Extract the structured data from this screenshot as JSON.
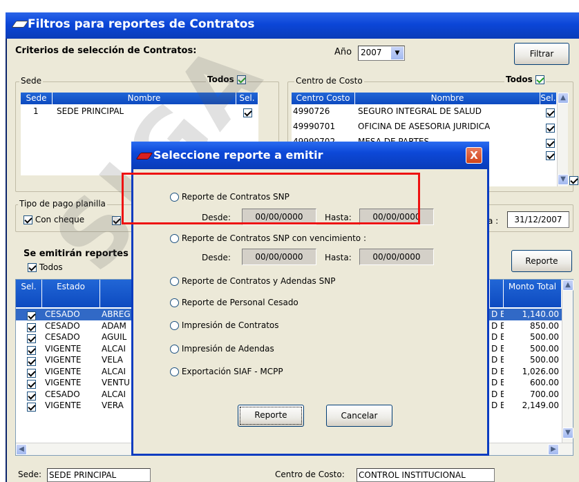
{
  "window": {
    "title": "Filtros para reportes de Contratos"
  },
  "criteria": {
    "label": "Criterios de selección de Contratos:",
    "year_label": "Año",
    "year_value": "2007",
    "filter_button": "Filtrar"
  },
  "sede_group": {
    "title": "Sede",
    "todos_label": "Todos",
    "columns": [
      "Sede",
      "Nombre",
      "Sel."
    ],
    "rows": [
      {
        "sede": "1",
        "nombre": "SEDE PRINCIPAL"
      }
    ]
  },
  "centro_group": {
    "title": "Centro de Costo",
    "todos_label": "Todos",
    "columns": [
      "Centro Costo",
      "Nombre",
      "Sel."
    ],
    "rows": [
      {
        "codigo": "4990726",
        "nombre": "SEGURO INTEGRAL DE SALUD"
      },
      {
        "codigo": "49990701",
        "nombre": "OFICINA DE ASESORIA JURIDICA"
      },
      {
        "codigo": "49990702",
        "nombre": "MESA DE PARTES"
      }
    ]
  },
  "pago_group": {
    "title": "Tipo de pago planilla",
    "con_cheque": "Con cheque",
    "date_suffix": "a :",
    "date_value": "31/12/2007"
  },
  "emitir": {
    "label": "Se emitirán reportes",
    "todos": "Todos",
    "report_button": "Reporte"
  },
  "main_table": {
    "col_sel": "Sel.",
    "col_estado": "Estado",
    "col_monto": "Monto Total",
    "rows": [
      {
        "estado": "CESADO",
        "nombre": "ABREG",
        "code": "D E",
        "monto": "1,140.00"
      },
      {
        "estado": "CESADO",
        "nombre": "ADAM",
        "code": "D E",
        "monto": "850.00"
      },
      {
        "estado": "CESADO",
        "nombre": "AGUIL",
        "code": "D E",
        "monto": "500.00"
      },
      {
        "estado": "VIGENTE",
        "nombre": "ALCAI",
        "code": "D E",
        "monto": "500.00"
      },
      {
        "estado": "VIGENTE",
        "nombre": "VELA",
        "code": "D E",
        "monto": "500.00"
      },
      {
        "estado": "VIGENTE",
        "nombre": "ALCAI",
        "code": "D E",
        "monto": "1,026.00"
      },
      {
        "estado": "VIGENTE",
        "nombre": "VENTU",
        "code": "D E",
        "monto": "600.00"
      },
      {
        "estado": "CESADO",
        "nombre": "ALCAI",
        "code": "D E",
        "monto": "700.00"
      },
      {
        "estado": "VIGENTE",
        "nombre": "VERA",
        "code": "D E",
        "monto": "2,149.00"
      }
    ]
  },
  "status": {
    "sede_label": "Sede:",
    "sede_value": "SEDE PRINCIPAL",
    "centro_label": "Centro de Costo:",
    "centro_value": "CONTROL INSTITUCIONAL"
  },
  "dialog": {
    "title": "Seleccione reporte a emitir",
    "close": "X",
    "options": [
      "Reporte de Contratos SNP",
      "Reporte de Contratos SNP con vencimiento :",
      "Reporte de Contratos y Adendas SNP",
      "Reporte de Personal Cesado",
      "Impresión de Contratos",
      "Impresión de Adendas",
      "Exportación SIAF - MCPP"
    ],
    "desde_label": "Desde:",
    "hasta_label": "Hasta:",
    "date_placeholder": "00/00/0000",
    "report_button": "Reporte",
    "cancel_button": "Cancelar"
  },
  "watermark": "SIGA",
  "colors": {
    "titlebar": "#0b46d8",
    "highlight": "#ee1111",
    "selected_row": "#3169c6"
  }
}
